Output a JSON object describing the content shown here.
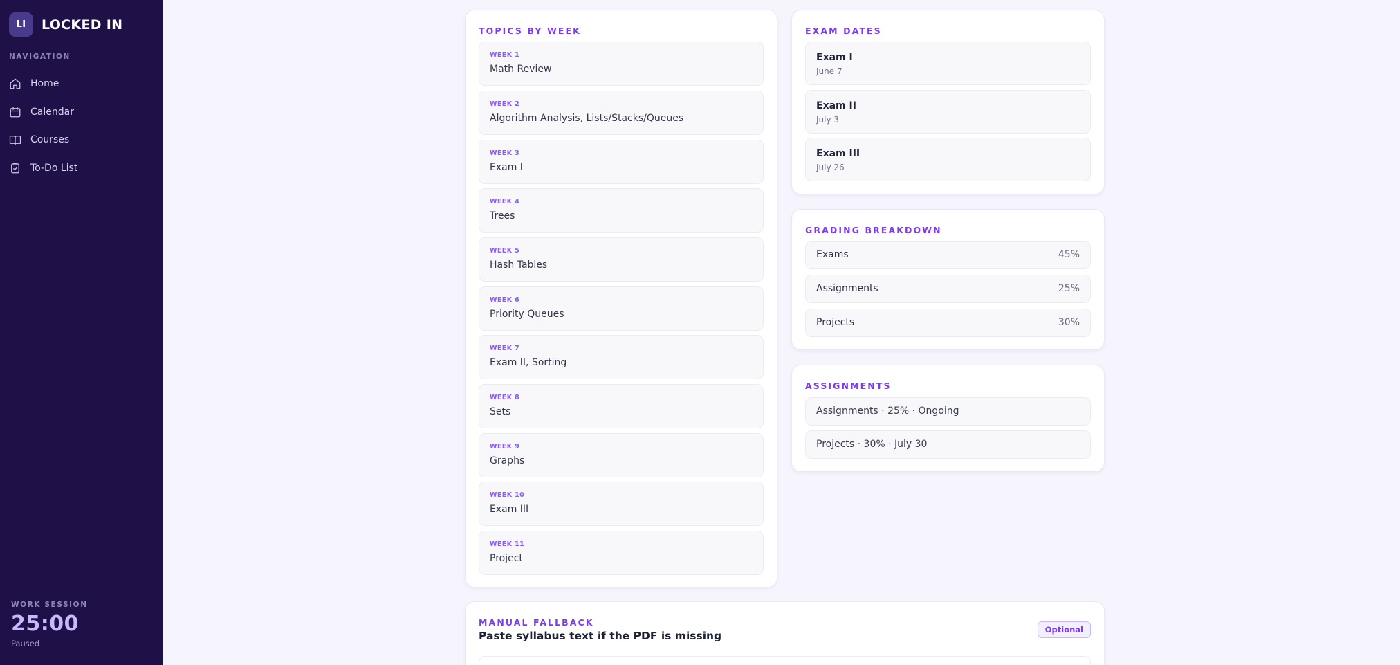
{
  "brand": {
    "logo_text": "LI",
    "name": "LOCKED IN"
  },
  "sidebar": {
    "nav_heading": "NAVIGATION",
    "items": [
      {
        "label": "Home",
        "icon": "home-icon"
      },
      {
        "label": "Calendar",
        "icon": "calendar-icon"
      },
      {
        "label": "Courses",
        "icon": "book-icon"
      },
      {
        "label": "To-Do List",
        "icon": "clipboard-check-icon"
      }
    ],
    "session": {
      "label": "WORK SESSION",
      "time": "25:00",
      "status": "Paused"
    }
  },
  "topics": {
    "title": "TOPICS BY WEEK",
    "weeks": [
      {
        "label": "WEEK 1",
        "topic": "Math Review"
      },
      {
        "label": "WEEK 2",
        "topic": "Algorithm Analysis, Lists/Stacks/Queues"
      },
      {
        "label": "WEEK 3",
        "topic": "Exam I"
      },
      {
        "label": "WEEK 4",
        "topic": "Trees"
      },
      {
        "label": "WEEK 5",
        "topic": "Hash Tables"
      },
      {
        "label": "WEEK 6",
        "topic": "Priority Queues"
      },
      {
        "label": "WEEK 7",
        "topic": "Exam II, Sorting"
      },
      {
        "label": "WEEK 8",
        "topic": "Sets"
      },
      {
        "label": "WEEK 9",
        "topic": "Graphs"
      },
      {
        "label": "WEEK 10",
        "topic": "Exam III"
      },
      {
        "label": "WEEK 11",
        "topic": "Project"
      }
    ]
  },
  "exams": {
    "title": "EXAM DATES",
    "items": [
      {
        "name": "Exam I",
        "date": "June 7"
      },
      {
        "name": "Exam II",
        "date": "July 3"
      },
      {
        "name": "Exam III",
        "date": "July 26"
      }
    ]
  },
  "grading": {
    "title": "GRADING BREAKDOWN",
    "items": [
      {
        "name": "Exams",
        "value": "45%"
      },
      {
        "name": "Assignments",
        "value": "25%"
      },
      {
        "name": "Projects",
        "value": "30%"
      }
    ]
  },
  "assignments": {
    "title": "ASSIGNMENTS",
    "items": [
      {
        "text": "Assignments · 25% · Ongoing"
      },
      {
        "text": "Projects · 30% · July 30"
      }
    ]
  },
  "fallback": {
    "title": "MANUAL FALLBACK",
    "subtitle": "Paste syllabus text if the PDF is missing",
    "badge": "Optional"
  },
  "colors": {
    "sidebar_bg": "#1f1147",
    "accent": "#7c3aed",
    "page_bg": "#f6f5fd"
  }
}
